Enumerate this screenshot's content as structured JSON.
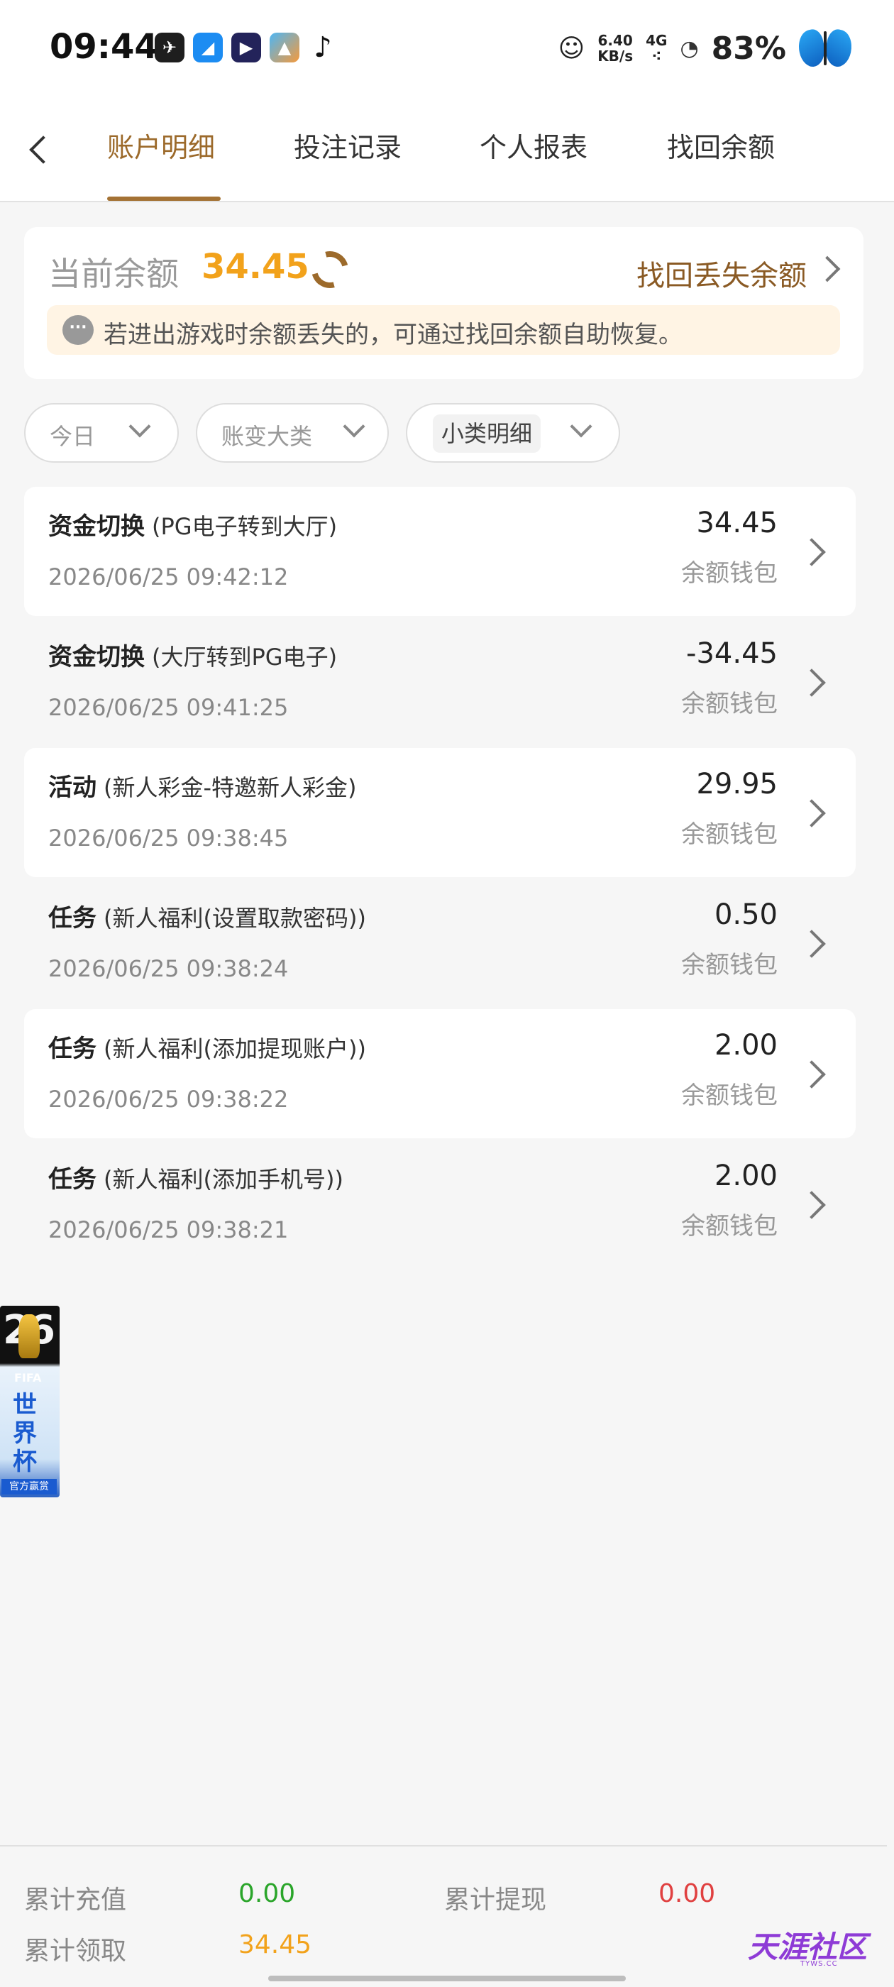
{
  "status_bar": {
    "time": "09:44",
    "app_icons": [
      "telegram-icon",
      "blue-app-icon",
      "video-app-icon",
      "gallery-icon",
      "tiktok-icon"
    ],
    "net_speed": "6.40",
    "net_unit": "KB/s",
    "network": "4G",
    "battery": "83%"
  },
  "tabs": [
    {
      "label": "账户明细",
      "active": true
    },
    {
      "label": "投注记录",
      "active": false
    },
    {
      "label": "个人报表",
      "active": false
    },
    {
      "label": "找回余额",
      "active": false
    }
  ],
  "balance": {
    "label": "当前余额",
    "value": "34.45",
    "recover_label": "找回丢失余额",
    "tip": "若进出游戏时余额丢失的，可通过找回余额自助恢复。"
  },
  "filters": [
    {
      "label": "今日"
    },
    {
      "label": "账变大类"
    },
    {
      "label": "小类明细"
    }
  ],
  "records": [
    {
      "title": "资金切换",
      "sub": "(PG电子转到大厅)",
      "time": "2026/06/25 09:42:12",
      "amount": "34.45",
      "wallet": "余额钱包"
    },
    {
      "title": "资金切换",
      "sub": "(大厅转到PG电子)",
      "time": "2026/06/25 09:41:25",
      "amount": "-34.45",
      "wallet": "余额钱包"
    },
    {
      "title": "活动",
      "sub": "(新人彩金-特邀新人彩金)",
      "time": "2026/06/25 09:38:45",
      "amount": "29.95",
      "wallet": "余额钱包"
    },
    {
      "title": "任务",
      "sub": "(新人福利(设置取款密码))",
      "time": "2026/06/25 09:38:24",
      "amount": "0.50",
      "wallet": "余额钱包"
    },
    {
      "title": "任务",
      "sub": "(新人福利(添加提现账户))",
      "time": "2026/06/25 09:38:22",
      "amount": "2.00",
      "wallet": "余额钱包"
    },
    {
      "title": "任务",
      "sub": "(新人福利(添加手机号))",
      "time": "2026/06/25 09:38:21",
      "amount": "2.00",
      "wallet": "余额钱包"
    }
  ],
  "banner": {
    "num": "26",
    "fifa": "FIFA",
    "title": "世界杯",
    "tag": "官方赢赏"
  },
  "summary": {
    "deposit_label": "累计充值",
    "deposit_value": "0.00",
    "withdraw_label": "累计提现",
    "withdraw_value": "0.00",
    "claim_label": "累计领取",
    "claim_value": "34.45"
  },
  "watermark": {
    "text": "天涯社区",
    "sub": "TYWS.CC"
  },
  "colors": {
    "accent": "#9c6a2b",
    "balance": "#f2a21b",
    "deposit": "#2aa52a",
    "withdraw": "#e04040",
    "claim": "#f2a21b"
  }
}
